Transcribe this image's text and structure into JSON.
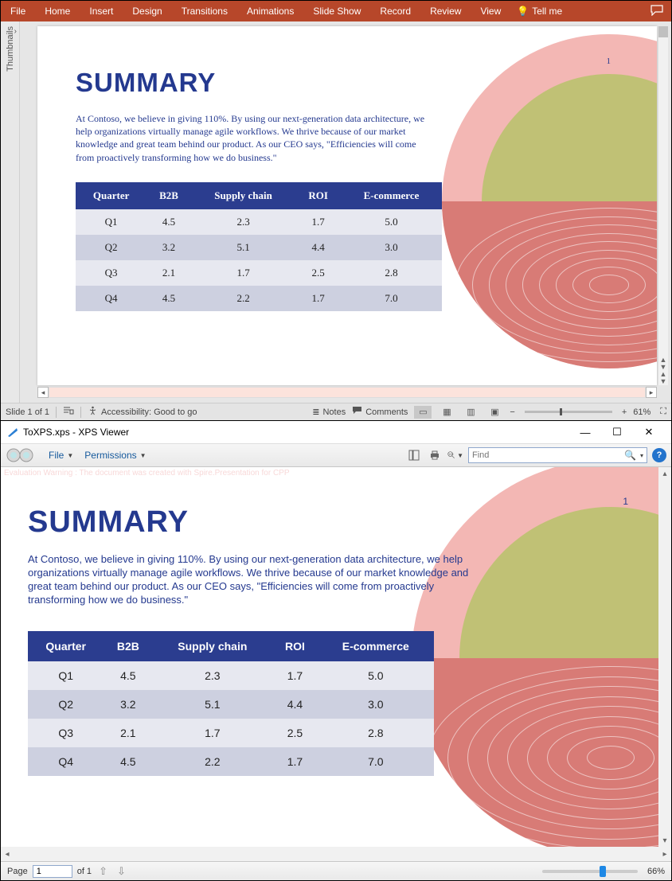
{
  "powerpoint": {
    "ribbon": {
      "tabs": [
        "File",
        "Home",
        "Insert",
        "Design",
        "Transitions",
        "Animations",
        "Slide Show",
        "Record",
        "Review",
        "View"
      ],
      "tellme": "Tell me"
    },
    "thumbnails_label": "Thumbnails",
    "status": {
      "slide": "Slide 1 of 1",
      "accessibility": "Accessibility: Good to go",
      "notes": "Notes",
      "comments": "Comments",
      "zoom": "61%"
    },
    "slide": {
      "page_number": "1",
      "title": "SUMMARY",
      "paragraph": "At Contoso, we believe in giving 110%. By using our next-generation data architecture, we help organizations virtually manage agile workflows. We thrive because of our market knowledge and great team behind our product. As our CEO says, \"Efficiencies will come from proactively transforming how we do business.\"",
      "table": {
        "headers": [
          "Quarter",
          "B2B",
          "Supply chain",
          "ROI",
          "E-commerce"
        ],
        "rows": [
          [
            "Q1",
            "4.5",
            "2.3",
            "1.7",
            "5.0"
          ],
          [
            "Q2",
            "3.2",
            "5.1",
            "4.4",
            "3.0"
          ],
          [
            "Q3",
            "2.1",
            "1.7",
            "2.5",
            "2.8"
          ],
          [
            "Q4",
            "4.5",
            "2.2",
            "1.7",
            "7.0"
          ]
        ]
      }
    }
  },
  "xps": {
    "titlebar": "ToXPS.xps - XPS Viewer",
    "toolbar": {
      "file": "File",
      "permissions": "Permissions",
      "find_placeholder": "Find"
    },
    "warning": "Evaluation Warning : The document was created with Spire.Presentation for CPP",
    "page": {
      "page_number": "1",
      "title": "SUMMARY",
      "paragraph": "At Contoso, we believe in giving 110%. By using our next-generation data architecture, we help organizations virtually manage agile workflows. We thrive because of our market knowledge and great team behind our product. As our CEO says, \"Efficiencies will come from proactively transforming how we do business.\"",
      "table": {
        "headers": [
          "Quarter",
          "B2B",
          "Supply chain",
          "ROI",
          "E-commerce"
        ],
        "rows": [
          [
            "Q1",
            "4.5",
            "2.3",
            "1.7",
            "5.0"
          ],
          [
            "Q2",
            "3.2",
            "5.1",
            "4.4",
            "3.0"
          ],
          [
            "Q3",
            "2.1",
            "1.7",
            "2.5",
            "2.8"
          ],
          [
            "Q4",
            "4.5",
            "2.2",
            "1.7",
            "7.0"
          ]
        ]
      }
    },
    "status": {
      "page_label": "Page",
      "page_value": "1",
      "page_total": "of  1",
      "zoom": "66%"
    }
  },
  "chart_data": {
    "type": "table",
    "title": "SUMMARY",
    "headers": [
      "Quarter",
      "B2B",
      "Supply chain",
      "ROI",
      "E-commerce"
    ],
    "rows": [
      {
        "Quarter": "Q1",
        "B2B": 4.5,
        "Supply chain": 2.3,
        "ROI": 1.7,
        "E-commerce": 5.0
      },
      {
        "Quarter": "Q2",
        "B2B": 3.2,
        "Supply chain": 5.1,
        "ROI": 4.4,
        "E-commerce": 3.0
      },
      {
        "Quarter": "Q3",
        "B2B": 2.1,
        "Supply chain": 1.7,
        "ROI": 2.5,
        "E-commerce": 2.8
      },
      {
        "Quarter": "Q4",
        "B2B": 4.5,
        "Supply chain": 2.2,
        "ROI": 1.7,
        "E-commerce": 7.0
      }
    ]
  }
}
